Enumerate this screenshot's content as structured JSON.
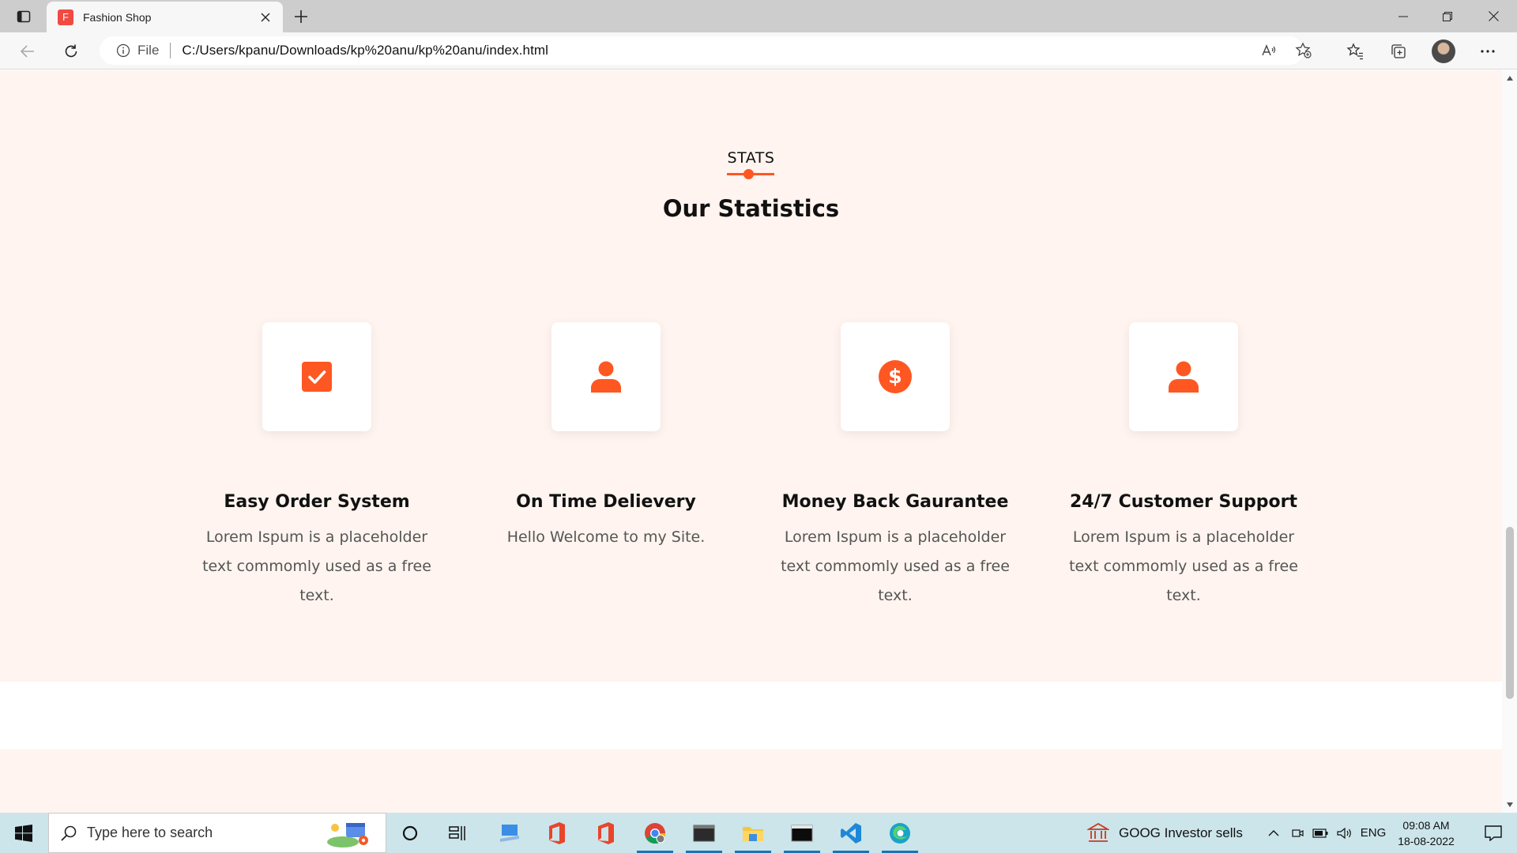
{
  "browser": {
    "tab_title": "Fashion Shop",
    "tab_favicon_letter": "F",
    "address_scheme_label": "File",
    "address_url": "C:/Users/kpanu/Downloads/kp%20anu/kp%20anu/index.html"
  },
  "page": {
    "section_tag": "STATS",
    "section_title": "Our Statistics",
    "accent_color": "#ff5722",
    "features": [
      {
        "icon": "checkbox-icon",
        "title": "Easy Order System",
        "desc": "Lorem Ispum is a placeholder text commomly used as a free text."
      },
      {
        "icon": "user-icon",
        "title": "On Time Delievery",
        "desc": "Hello Welcome to my Site."
      },
      {
        "icon": "dollar-icon",
        "title": "Money Back Gaurantee",
        "desc": "Lorem Ispum is a placeholder text commomly used as a free text."
      },
      {
        "icon": "user-icon",
        "title": "24/7 Customer Support",
        "desc": "Lorem Ispum is a placeholder text commomly used as a free text."
      }
    ]
  },
  "taskbar": {
    "search_placeholder": "Type here to search",
    "news_ticker": "GOOG  Investor sells",
    "language": "ENG",
    "time": "09:08 AM",
    "date": "18-08-2022"
  }
}
